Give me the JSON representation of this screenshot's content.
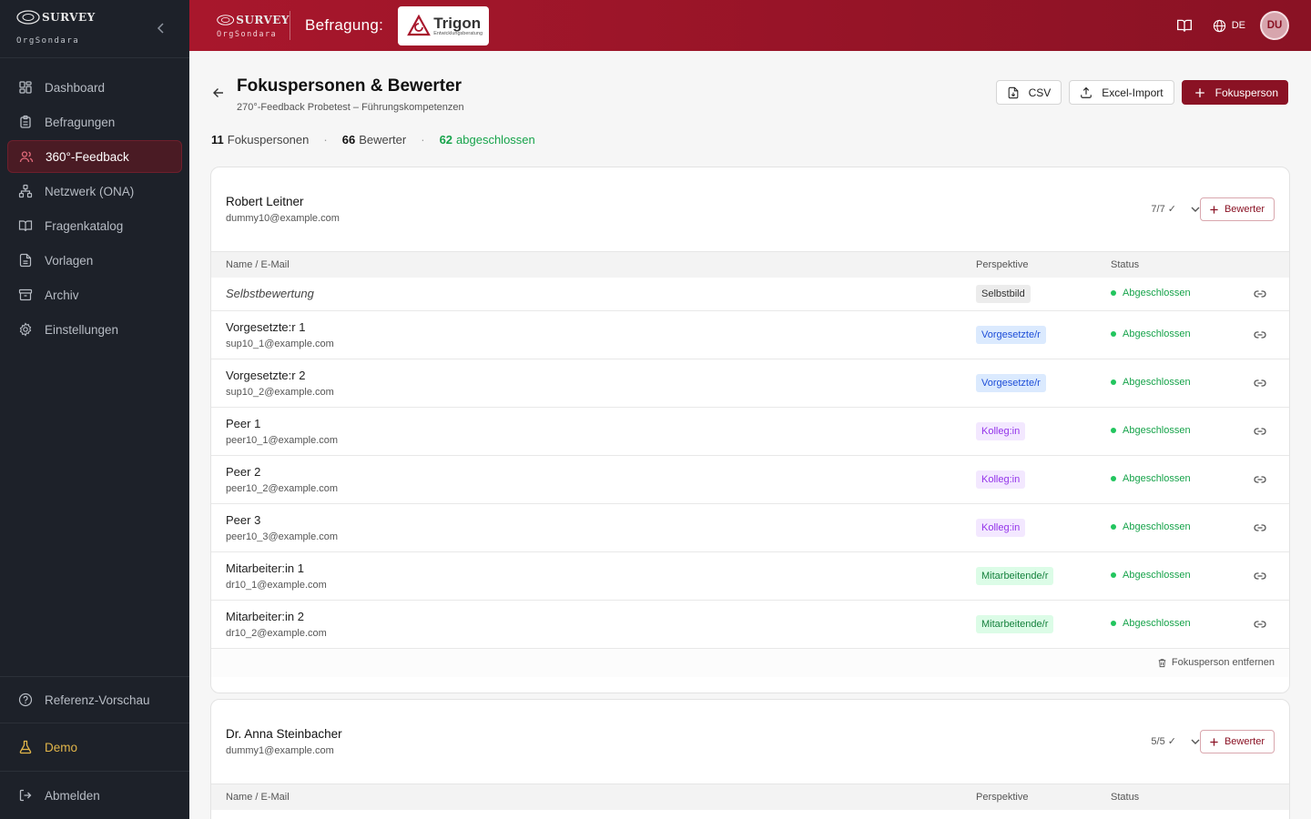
{
  "brand": {
    "logo_word": "SURVEY",
    "logo_sub": "OrgSondara"
  },
  "sidebar": {
    "items": [
      {
        "label": "Dashboard",
        "icon": "dashboard-icon"
      },
      {
        "label": "Befragungen",
        "icon": "clipboard-icon"
      },
      {
        "label": "360°-Feedback",
        "icon": "users-icon",
        "active": true
      },
      {
        "label": "Netzwerk (ONA)",
        "icon": "network-icon"
      },
      {
        "label": "Fragenkatalog",
        "icon": "book-icon"
      },
      {
        "label": "Vorlagen",
        "icon": "file-icon"
      },
      {
        "label": "Archiv",
        "icon": "archive-icon"
      },
      {
        "label": "Einstellungen",
        "icon": "gear-icon"
      }
    ],
    "bottom": {
      "reference_preview": "Referenz-Vorschau",
      "demo": "Demo",
      "logout": "Abmelden"
    }
  },
  "topbar": {
    "survey_label": "Befragung:",
    "client_name": "Trigon",
    "client_sub": "Entwicklungsberatung",
    "language": "DE",
    "user_initials": "DU"
  },
  "page": {
    "title": "Fokuspersonen & Bewerter",
    "subtitle": "270°-Feedback Probetest – Führungskompetenzen",
    "actions": {
      "csv": "CSV",
      "excel_import": "Excel-Import",
      "add_focus": "Fokusperson"
    },
    "stats": {
      "focus_count": "11",
      "focus_label": "Fokuspersonen",
      "rater_count": "66",
      "rater_label": "Bewerter",
      "done_count": "62",
      "done_label": "abgeschlossen"
    }
  },
  "table_headers": {
    "name": "Name / E-Mail",
    "perspective": "Perspektive",
    "status": "Status"
  },
  "focus_persons": [
    {
      "name": "Robert Leitner",
      "email": "dummy10@example.com",
      "progress": "7/7 ✓",
      "add_rater": "Bewerter",
      "remove": "Fokusperson entfernen",
      "raters": [
        {
          "name": "Selbstbewertung",
          "email": "",
          "perspective": "Selbstbild",
          "status": "Abgeschlossen"
        },
        {
          "name": "Vorgesetzte:r 1",
          "email": "sup10_1@example.com",
          "perspective": "Vorgesetzte/r",
          "status": "Abgeschlossen"
        },
        {
          "name": "Vorgesetzte:r 2",
          "email": "sup10_2@example.com",
          "perspective": "Vorgesetzte/r",
          "status": "Abgeschlossen"
        },
        {
          "name": "Peer 1",
          "email": "peer10_1@example.com",
          "perspective": "Kolleg:in",
          "status": "Abgeschlossen"
        },
        {
          "name": "Peer 2",
          "email": "peer10_2@example.com",
          "perspective": "Kolleg:in",
          "status": "Abgeschlossen"
        },
        {
          "name": "Peer 3",
          "email": "peer10_3@example.com",
          "perspective": "Kolleg:in",
          "status": "Abgeschlossen"
        },
        {
          "name": "Mitarbeiter:in 1",
          "email": "dr10_1@example.com",
          "perspective": "Mitarbeitende/r",
          "status": "Abgeschlossen"
        },
        {
          "name": "Mitarbeiter:in 2",
          "email": "dr10_2@example.com",
          "perspective": "Mitarbeitende/r",
          "status": "Abgeschlossen"
        }
      ]
    },
    {
      "name": "Dr. Anna Steinbacher",
      "email": "dummy1@example.com",
      "progress": "5/5 ✓",
      "add_rater": "Bewerter"
    }
  ],
  "colors": {
    "brand": "#8a1224",
    "sidebar_bg": "#1d2129",
    "success": "#16a34a"
  }
}
